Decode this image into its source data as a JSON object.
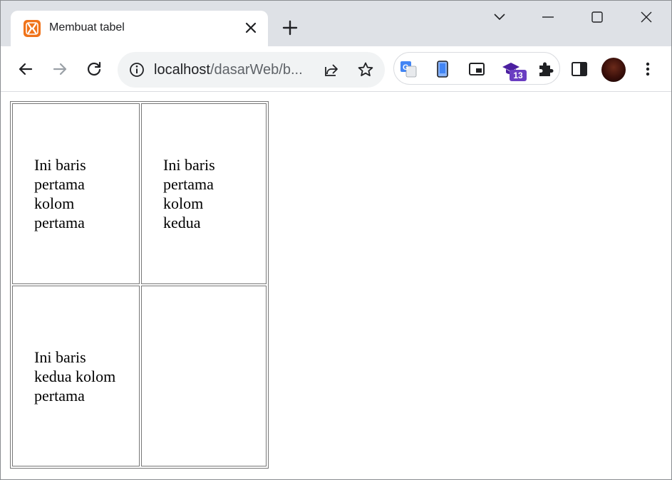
{
  "browser": {
    "tab": {
      "title": "Membuat tabel",
      "favicon": "xampp-icon"
    },
    "omnibox": {
      "host": "localhost",
      "path": "/dasarWeb/b..."
    },
    "extensions": {
      "badge_count": "13"
    },
    "colors": {
      "tabstrip": "#dee1e6",
      "favicon": "#f0731a",
      "badge": "#6a3ec2"
    }
  },
  "table": {
    "rows": [
      [
        "Ini baris pertama kolom pertama",
        "Ini baris pertama kolom kedua"
      ],
      [
        "Ini baris kedua kolom pertama",
        ""
      ]
    ]
  }
}
